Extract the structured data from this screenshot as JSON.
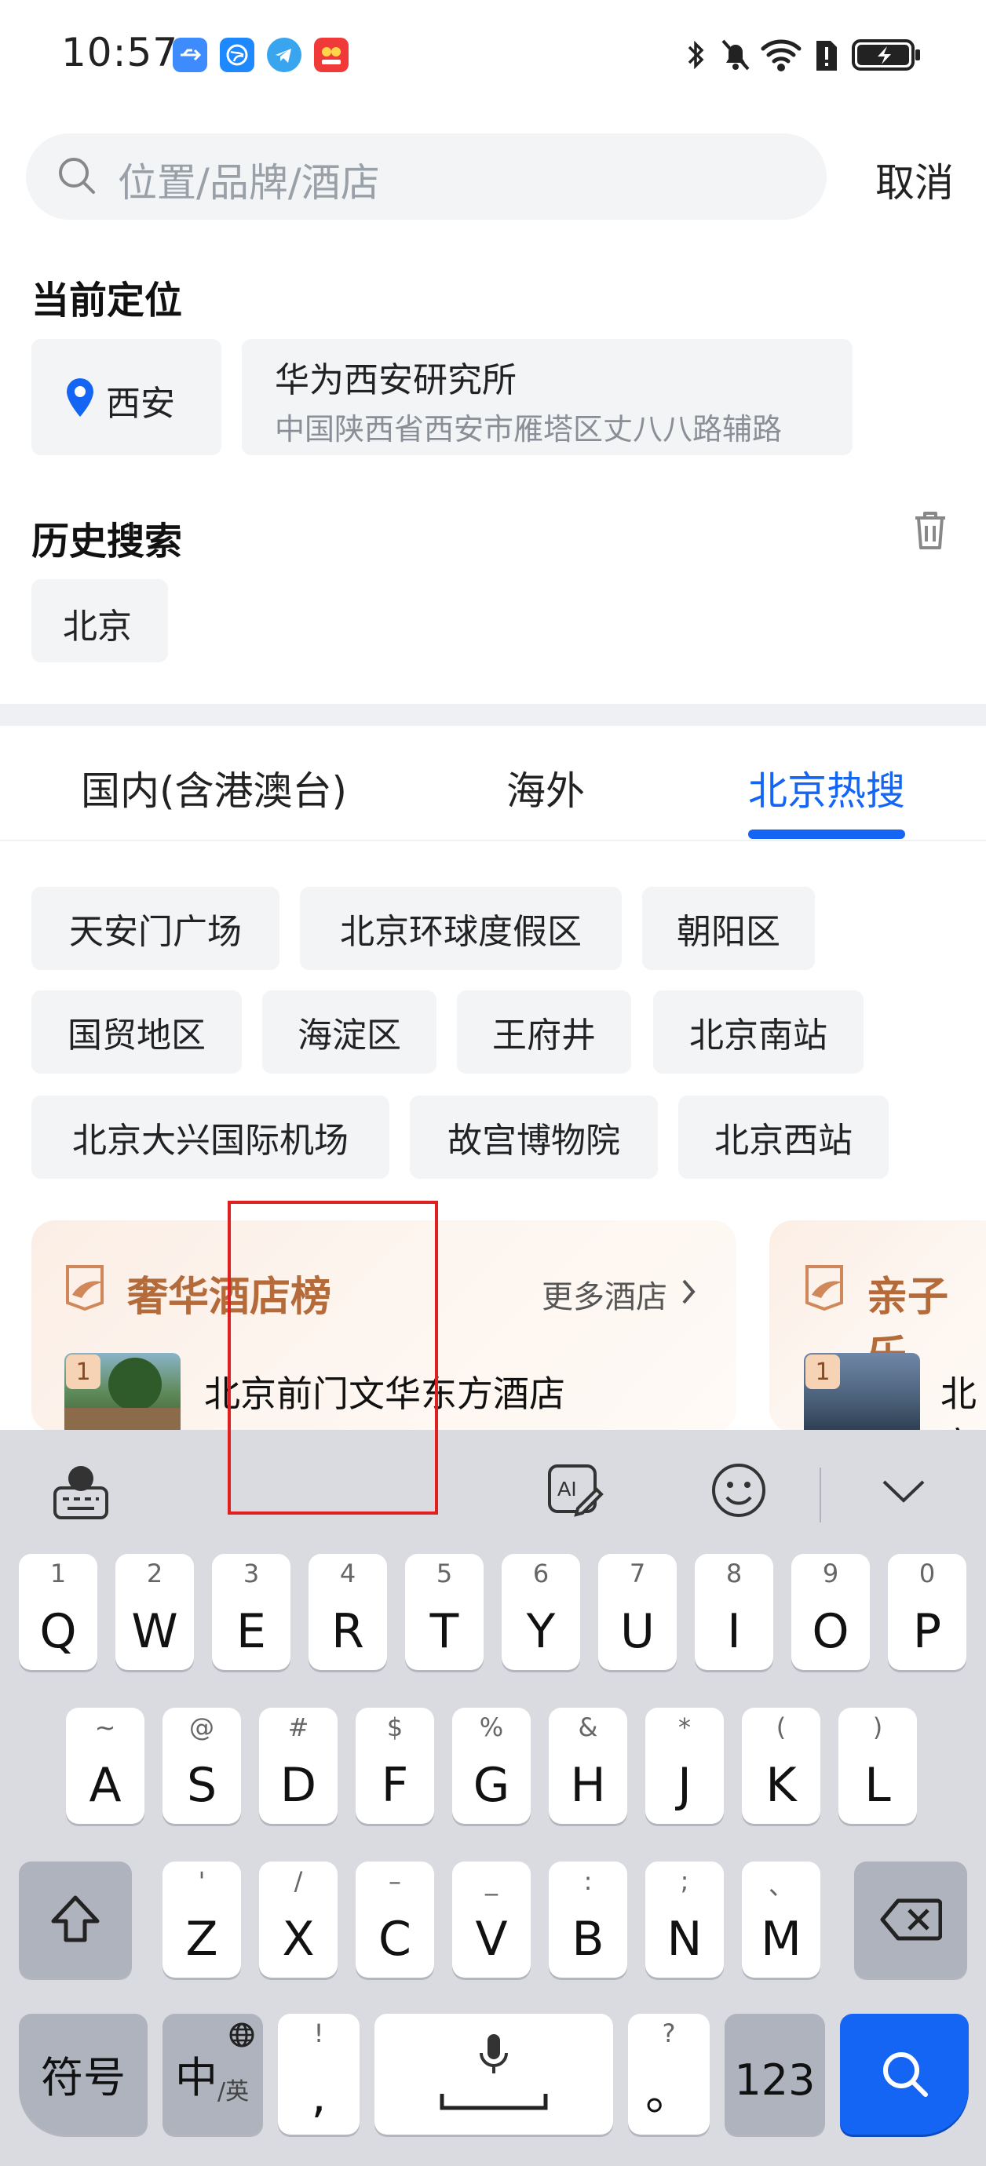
{
  "status_bar": {
    "time": "10:57"
  },
  "search": {
    "placeholder": "位置/品牌/酒店",
    "cancel_label": "取消"
  },
  "current_location": {
    "title": "当前定位",
    "city": "西安",
    "place_name": "华为西安研究所",
    "place_address": "中国陕西省西安市雁塔区丈八八路辅路"
  },
  "history": {
    "title": "历史搜索",
    "items": [
      "北京"
    ]
  },
  "tabs": [
    {
      "label": "国内(含港澳台)",
      "active": false
    },
    {
      "label": "海外",
      "active": false
    },
    {
      "label": "北京热搜",
      "active": true
    }
  ],
  "hot_tags": [
    [
      "天安门广场",
      "北京环球度假区",
      "朝阳区"
    ],
    [
      "国贸地区",
      "海淀区",
      "王府井",
      "北京南站"
    ],
    [
      "北京大兴国际机场",
      "故宫博物院",
      "北京西站"
    ]
  ],
  "cards": [
    {
      "title": "奢华酒店榜",
      "more_label": "更多酒店",
      "first_rank": "1",
      "first_hotel": "北京前门文华东方酒店"
    },
    {
      "title": "亲子乐",
      "first_rank": "1",
      "first_hotel": "北京"
    }
  ],
  "keyboard": {
    "row1": [
      {
        "hint": "1",
        "key": "Q"
      },
      {
        "hint": "2",
        "key": "W"
      },
      {
        "hint": "3",
        "key": "E"
      },
      {
        "hint": "4",
        "key": "R"
      },
      {
        "hint": "5",
        "key": "T"
      },
      {
        "hint": "6",
        "key": "Y"
      },
      {
        "hint": "7",
        "key": "U"
      },
      {
        "hint": "8",
        "key": "I"
      },
      {
        "hint": "9",
        "key": "O"
      },
      {
        "hint": "0",
        "key": "P"
      }
    ],
    "row2": [
      {
        "hint": "~",
        "key": "A"
      },
      {
        "hint": "@",
        "key": "S"
      },
      {
        "hint": "#",
        "key": "D"
      },
      {
        "hint": "$",
        "key": "F"
      },
      {
        "hint": "%",
        "key": "G"
      },
      {
        "hint": "&",
        "key": "H"
      },
      {
        "hint": "*",
        "key": "J"
      },
      {
        "hint": "(",
        "key": "K"
      },
      {
        "hint": ")",
        "key": "L"
      }
    ],
    "row3": [
      {
        "hint": "'",
        "key": "Z"
      },
      {
        "hint": "/",
        "key": "X"
      },
      {
        "hint": "–",
        "key": "C"
      },
      {
        "hint": "_",
        "key": "V"
      },
      {
        "hint": ":",
        "key": "B"
      },
      {
        "hint": ";",
        "key": "N"
      },
      {
        "hint": "、",
        "key": "M"
      }
    ],
    "symbols_label": "符号",
    "lang_label": "中",
    "lang_sub": "/英",
    "comma_hint": "!",
    "comma_key": ",",
    "period_hint": "?",
    "period_key": "。",
    "numbers_label": "123"
  }
}
